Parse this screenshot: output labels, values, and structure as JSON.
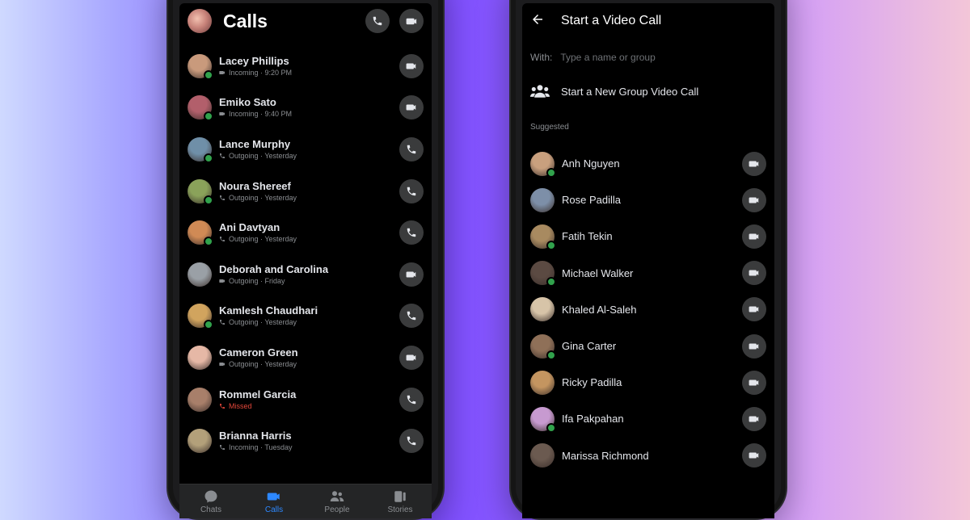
{
  "calls_screen": {
    "title": "Calls",
    "calls": [
      {
        "name": "Lacey Phillips",
        "meta": "Incoming · 9:20 PM",
        "type": "video",
        "missed": false,
        "online": true,
        "avatar_color": "#c99a7c"
      },
      {
        "name": "Emiko Sato",
        "meta": "Incoming · 9:40 PM",
        "type": "video",
        "missed": false,
        "online": true,
        "avatar_color": "#b25f6b"
      },
      {
        "name": "Lance Murphy",
        "meta": "Outgoing · Yesterday",
        "type": "audio",
        "missed": false,
        "online": true,
        "avatar_color": "#6f8fa8"
      },
      {
        "name": "Noura Shereef",
        "meta": "Outgoing · Yesterday",
        "type": "audio",
        "missed": false,
        "online": true,
        "avatar_color": "#8aa25a"
      },
      {
        "name": "Ani Davtyan",
        "meta": "Outgoing · Yesterday",
        "type": "audio",
        "missed": false,
        "online": true,
        "avatar_color": "#d08a55"
      },
      {
        "name": "Deborah and Carolina",
        "meta": "Outgoing · Friday",
        "type": "video",
        "missed": false,
        "online": false,
        "avatar_color": "#9aa0a6"
      },
      {
        "name": "Kamlesh Chaudhari",
        "meta": "Outgoing · Yesterday",
        "type": "audio",
        "missed": false,
        "online": true,
        "avatar_color": "#d1a45e"
      },
      {
        "name": "Cameron Green",
        "meta": "Outgoing · Yesterday",
        "type": "video",
        "missed": false,
        "online": false,
        "avatar_color": "#e6b8a6"
      },
      {
        "name": "Rommel Garcia",
        "meta": "Missed",
        "type": "audio",
        "missed": true,
        "online": false,
        "avatar_color": "#a87f6a"
      },
      {
        "name": "Brianna Harris",
        "meta": "Incoming · Tuesday",
        "type": "audio",
        "missed": false,
        "online": false,
        "avatar_color": "#b3a07a"
      }
    ],
    "nav": [
      {
        "label": "Chats",
        "icon": "chat-bubble-icon",
        "active": false
      },
      {
        "label": "Calls",
        "icon": "video-camera-icon",
        "active": true
      },
      {
        "label": "People",
        "icon": "people-icon",
        "active": false
      },
      {
        "label": "Stories",
        "icon": "stories-icon",
        "active": false
      }
    ],
    "colors": {
      "accent": "#2d88ff",
      "missed": "#e4473a",
      "online": "#31a24c"
    }
  },
  "video_call_screen": {
    "title": "Start a Video Call",
    "with_label": "With:",
    "with_placeholder": "Type a name or group",
    "group_call_label": "Start a New Group Video Call",
    "suggested_label": "Suggested",
    "suggested": [
      {
        "name": "Anh Nguyen",
        "online": true,
        "avatar_color": "#c9a07e"
      },
      {
        "name": "Rose Padilla",
        "online": false,
        "avatar_color": "#7d8fa8"
      },
      {
        "name": "Fatih Tekin",
        "online": true,
        "avatar_color": "#a88a60"
      },
      {
        "name": "Michael Walker",
        "online": true,
        "avatar_color": "#5b4a42"
      },
      {
        "name": "Khaled Al-Saleh",
        "online": false,
        "avatar_color": "#d7c4a8"
      },
      {
        "name": "Gina Carter",
        "online": true,
        "avatar_color": "#8f7058"
      },
      {
        "name": "Ricky Padilla",
        "online": false,
        "avatar_color": "#c49560"
      },
      {
        "name": "Ifa Pakpahan",
        "online": true,
        "avatar_color": "#c79ad0"
      },
      {
        "name": "Marissa Richmond",
        "online": false,
        "avatar_color": "#6b5a50"
      }
    ]
  }
}
